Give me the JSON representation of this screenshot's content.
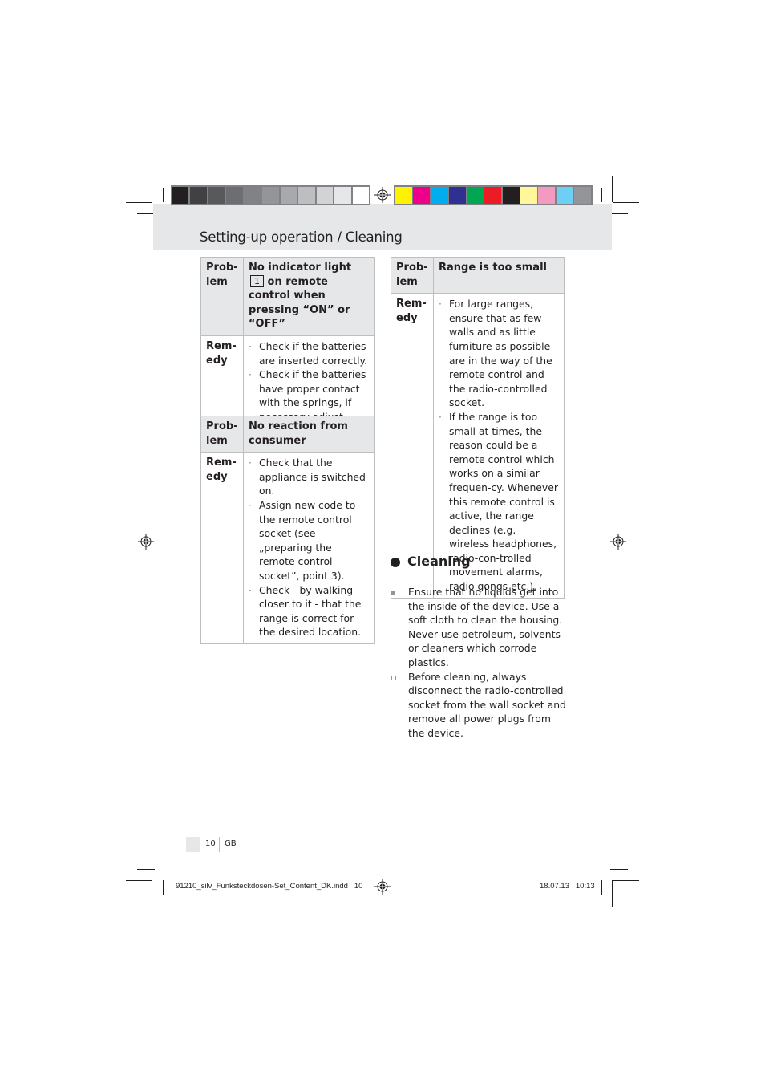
{
  "header": {
    "title": "Setting-up operation / Cleaning",
    "gray_swatches": [
      "#231f20",
      "#414042",
      "#58595b",
      "#6d6e71",
      "#808285",
      "#939598",
      "#a7a9ac",
      "#bcbec0",
      "#d1d3d4",
      "#e6e7e8",
      "#ffffff"
    ],
    "color_swatches": [
      "#fff200",
      "#ec008c",
      "#00aeef",
      "#2e3192",
      "#00a651",
      "#ed1c24",
      "#231f20",
      "#fff799",
      "#f49ac1",
      "#6dcff6",
      "#939598"
    ]
  },
  "labels": {
    "problem_line1": "Prob-",
    "problem_line2": "lem",
    "remedy_line1": "Rem-",
    "remedy_line2": "edy"
  },
  "tables": [
    {
      "problem": "No indicator light",
      "problem_ref": "1",
      "problem_cont": "on remote control when pressing “ON” or “OFF”",
      "remedies": [
        "Check if the batteries are inserted correctly.",
        "Check if the batteries have proper contact with the springs, if necessary adjust."
      ]
    },
    {
      "problem": "No reaction from consumer",
      "remedies": [
        "Check that the appliance is switched on.",
        "Assign new code to the remote control socket (see „preparing the remote control socket”, point 3).",
        "Check - by walking closer to it - that the range is correct for the desired location."
      ]
    },
    {
      "problem": "Range is too small",
      "remedies": [
        "For large ranges, ensure that as few walls and as little furniture as possible are in the way of the remote control and the radio-controlled socket.",
        "If the range is too small at times, the reason could be a remote control which works on a similar frequen-cy. Whenever this remote control is active, the range declines (e.g. wireless headphones, radio-con-trolled movement alarms, radio gongs etc.)."
      ]
    }
  ],
  "cleaning": {
    "title": "Cleaning",
    "items": [
      "Ensure that no liquids get into the inside of the device. Use a soft cloth to clean the housing. Never use petroleum, solvents or cleaners which corrode plastics.",
      "Before cleaning, always disconnect the radio-controlled socket from the wall socket and remove all power plugs from the device."
    ]
  },
  "footer": {
    "page_number": "10",
    "language": "GB",
    "slug_file": "91210_silv_Funksteckdosen-Set_Content_DK.indd   10",
    "slug_date": "18.07.13   10:13"
  },
  "icons": {
    "registration": "registration-mark-icon"
  }
}
